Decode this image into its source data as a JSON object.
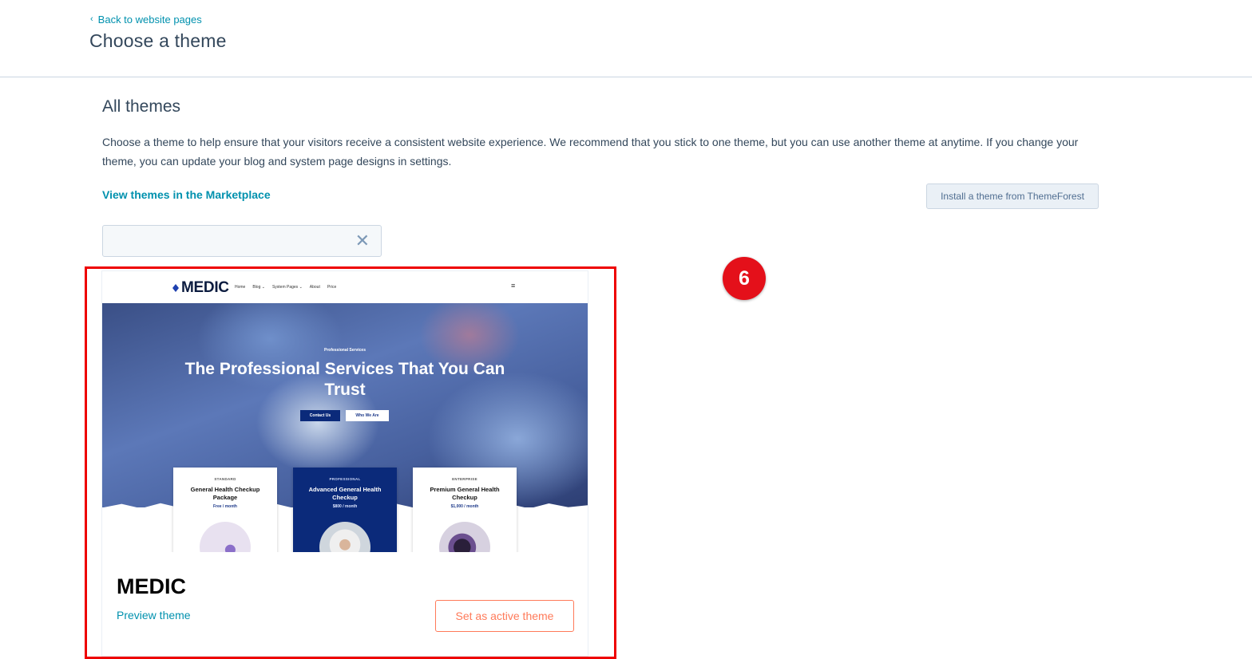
{
  "header": {
    "back_link": "Back to website pages",
    "title": "Choose a theme"
  },
  "main": {
    "section_title": "All themes",
    "description": "Choose a theme to help ensure that your visitors receive a consistent website experience. We recommend that you stick to one theme, but you can use another theme at anytime. If you change your theme, you can update your blog and system page designs in settings.",
    "marketplace_link": "View themes in the Marketplace",
    "install_button": "Install a theme from ThemeForest",
    "search": {
      "value": "",
      "clear_icon": "close-icon"
    }
  },
  "theme_card": {
    "name": "MEDIC",
    "preview_link": "Preview theme",
    "active_button": "Set as active theme",
    "preview": {
      "logo": "MEDIC",
      "menu": [
        "Home",
        "Blog ⌄",
        "System Pages ⌄",
        "About",
        "Price"
      ],
      "hero_eyebrow": "Professional Services",
      "hero_title": "The Professional Services That You Can Trust",
      "hero_buttons": [
        "Contact Us",
        "Who We Are"
      ],
      "plans": [
        {
          "tier": "STANDARD",
          "name": "General Health Checkup Package",
          "price": "Free / month"
        },
        {
          "tier": "PROFESSIONAL",
          "name": "Advanced General Health Checkup",
          "price": "$800 / month"
        },
        {
          "tier": "ENTERPRISE",
          "name": "Premium General Health Checkup",
          "price": "$1,000 / month"
        }
      ]
    }
  },
  "annotation": {
    "step": "6",
    "highlight_color": "#ee0000"
  },
  "colors": {
    "link": "#0091ae",
    "accent": "#ff7a59",
    "text": "#33475b",
    "border": "#cbd6e2"
  }
}
